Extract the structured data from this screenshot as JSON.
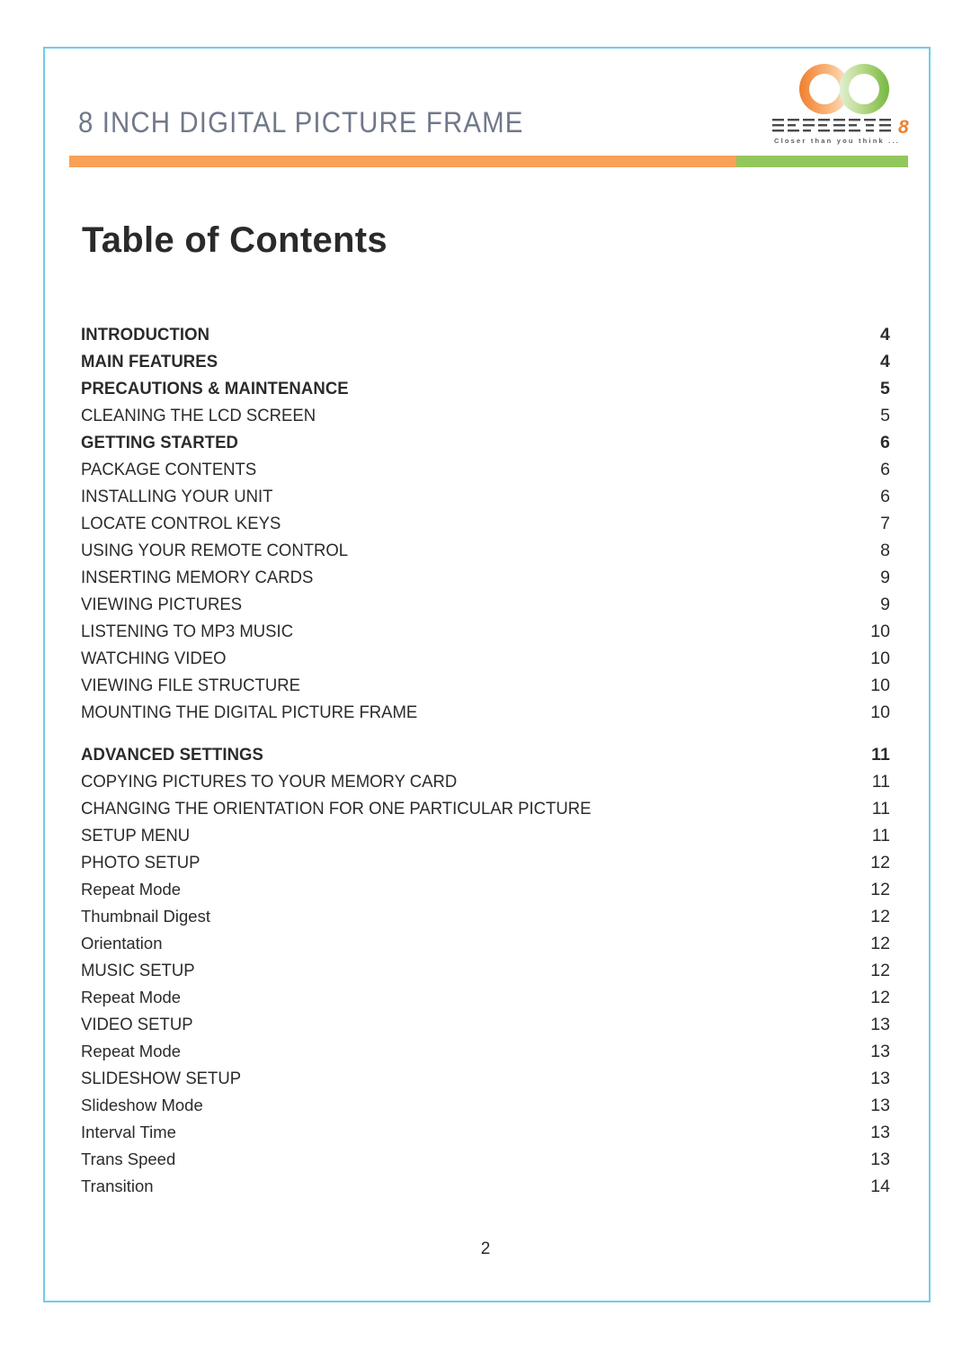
{
  "header": {
    "title": "8 INCH DIGITAL PICTURE FRAME",
    "brand": {
      "logo_icon": "infinity-loop-icon",
      "wordmark": "INFINITY",
      "numeral": "8",
      "tagline": "Closer than you think ...",
      "orange": "#F9A059",
      "green": "#92C75C"
    }
  },
  "rule": {
    "orange": "#F9A059",
    "green": "#92C75C"
  },
  "title": "Table of Contents",
  "toc": {
    "entries": [
      {
        "label": "INTRODUCTION",
        "page": "4",
        "level": "major"
      },
      {
        "label": "MAIN FEATURES",
        "page": "4",
        "level": "major"
      },
      {
        "label": "PRECAUTIONS & MAINTENANCE",
        "page": "5",
        "level": "major"
      },
      {
        "label": "CLEANING THE LCD SCREEN",
        "page": "5",
        "level": "section"
      },
      {
        "label": "GETTING STARTED",
        "page": "6",
        "level": "major"
      },
      {
        "label": "PACKAGE CONTENTS",
        "page": "6",
        "level": "section"
      },
      {
        "label": "INSTALLING YOUR UNIT",
        "page": "6",
        "level": "section"
      },
      {
        "label": "LOCATE CONTROL KEYS",
        "page": "7",
        "level": "section"
      },
      {
        "label": "USING YOUR REMOTE CONTROL",
        "page": "8",
        "level": "section"
      },
      {
        "label": "INSERTING MEMORY CARDS",
        "page": "9",
        "level": "section"
      },
      {
        "label": "VIEWING PICTURES",
        "page": "9",
        "level": "section"
      },
      {
        "label": "LISTENING TO MP3 MUSIC",
        "page": "10",
        "level": "section"
      },
      {
        "label": "WATCHING VIDEO",
        "page": "10",
        "level": "section"
      },
      {
        "label": "VIEWING FILE STRUCTURE",
        "page": "10",
        "level": "section"
      },
      {
        "label": "MOUNTING THE DIGITAL PICTURE FRAME",
        "page": "10",
        "level": "section"
      },
      {
        "label": "ADVANCED SETTINGS",
        "page": "11",
        "level": "major",
        "spaced": true
      },
      {
        "label": "COPYING PICTURES TO YOUR MEMORY CARD",
        "page": "11",
        "level": "section"
      },
      {
        "label": "CHANGING THE ORIENTATION FOR ONE PARTICULAR PICTURE",
        "page": "11",
        "level": "section"
      },
      {
        "label": "SETUP MENU",
        "page": "11",
        "level": "section"
      },
      {
        "label": "PHOTO SETUP",
        "page": "12",
        "level": "section"
      },
      {
        "label": "Repeat Mode",
        "page": "12",
        "level": "sub"
      },
      {
        "label": "Thumbnail Digest",
        "page": "12",
        "level": "sub"
      },
      {
        "label": "Orientation",
        "page": "12",
        "level": "sub"
      },
      {
        "label": "MUSIC SETUP",
        "page": "12",
        "level": "section"
      },
      {
        "label": "Repeat Mode",
        "page": "12",
        "level": "sub"
      },
      {
        "label": "VIDEO SETUP",
        "page": "13",
        "level": "section"
      },
      {
        "label": "Repeat Mode",
        "page": "13",
        "level": "sub"
      },
      {
        "label": "SLIDESHOW SETUP",
        "page": "13",
        "level": "section"
      },
      {
        "label": "Slideshow Mode",
        "page": "13",
        "level": "sub"
      },
      {
        "label": "Interval Time",
        "page": "13",
        "level": "sub"
      },
      {
        "label": "Trans Speed",
        "page": "13",
        "level": "sub"
      },
      {
        "label": "Transition",
        "page": "14",
        "level": "sub"
      }
    ]
  },
  "footer": {
    "page_number": "2"
  }
}
